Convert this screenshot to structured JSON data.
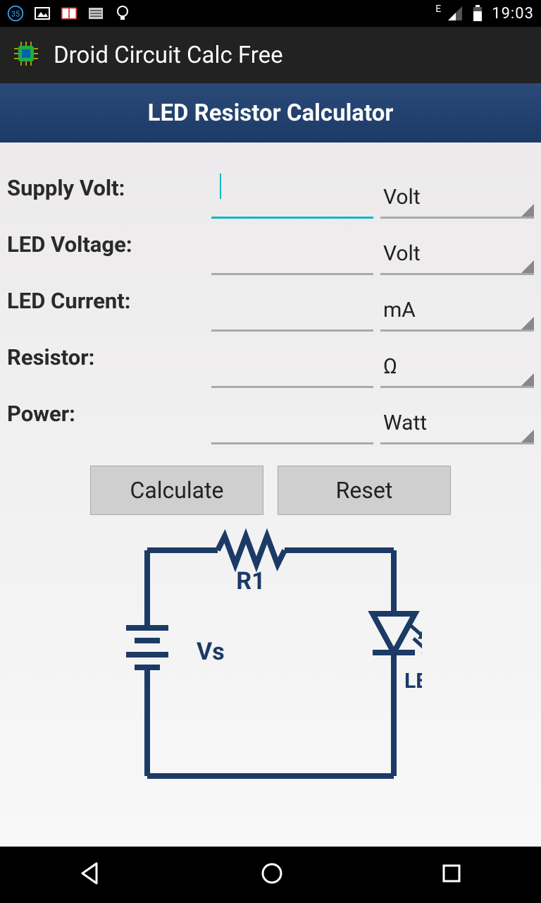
{
  "status": {
    "badge": "35",
    "time": "19:03",
    "network": "E"
  },
  "app": {
    "title": "Droid Circuit Calc Free"
  },
  "header": {
    "title": "LED Resistor Calculator"
  },
  "form": {
    "rows": [
      {
        "label": "Supply Volt:",
        "value": "",
        "unit": "Volt",
        "focused": true
      },
      {
        "label": "LED Voltage:",
        "value": "",
        "unit": "Volt",
        "focused": false
      },
      {
        "label": "LED Current:",
        "value": "",
        "unit": "mA",
        "focused": false
      },
      {
        "label": "Resistor:",
        "value": "",
        "unit": "Ω",
        "focused": false
      },
      {
        "label": "Power:",
        "value": "",
        "unit": "Watt",
        "focused": false
      }
    ]
  },
  "buttons": {
    "calculate": "Calculate",
    "reset": "Reset"
  },
  "diagram": {
    "r1": "R1",
    "vs": "Vs",
    "led": "LED"
  }
}
